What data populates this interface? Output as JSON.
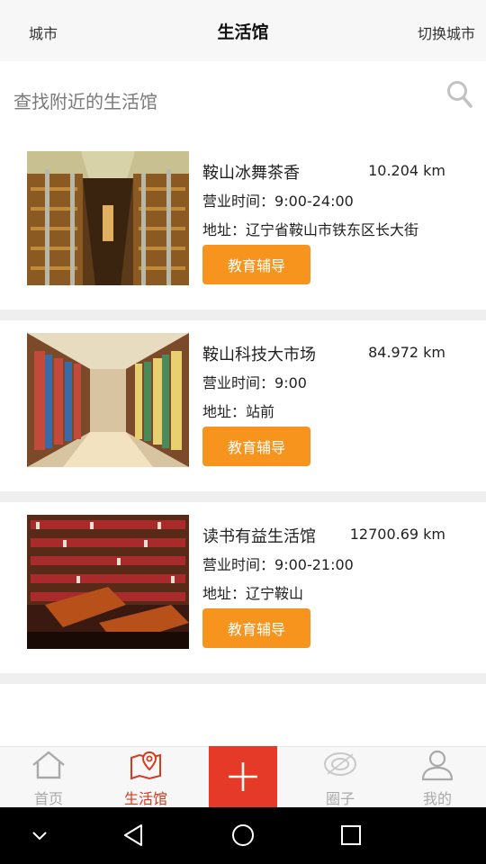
{
  "header": {
    "city_label": "城市",
    "title": "生活馆",
    "switch_city_label": "切换城市"
  },
  "search": {
    "placeholder": "查找附近的生活馆",
    "icon": "search-icon"
  },
  "list": {
    "hours_prefix": "营业时间：",
    "address_prefix": "地址：",
    "items": [
      {
        "name": "鞍山冰舞茶香",
        "distance": "10.204 km",
        "hours": "9:00-24:00",
        "address": "辽宁省鞍山市铁东区长大街",
        "tag": "教育辅导",
        "image": "library-hall-photo"
      },
      {
        "name": "鞍山科技大市场",
        "distance": "84.972 km",
        "hours": "9:00",
        "address": "站前",
        "tag": "教育辅导",
        "image": "bookstore-aisle-photo"
      },
      {
        "name": "读书有益生活馆",
        "distance": "12700.69 km",
        "hours": "9:00-21:00",
        "address": "辽宁鞍山",
        "tag": "教育辅导",
        "image": "reading-room-photo"
      }
    ]
  },
  "tabbar": {
    "tabs": [
      {
        "label": "首页",
        "icon": "home-icon"
      },
      {
        "label": "生活馆",
        "icon": "map-pin-icon",
        "active": true
      },
      {
        "label": "",
        "icon": "plus-icon"
      },
      {
        "label": "圈子",
        "icon": "eye-icon"
      },
      {
        "label": "我的",
        "icon": "person-icon"
      }
    ]
  },
  "colors": {
    "accent": "#f7941d",
    "active": "#d9391f",
    "add_button": "#e53a27",
    "inactive": "#a9a9a9"
  }
}
